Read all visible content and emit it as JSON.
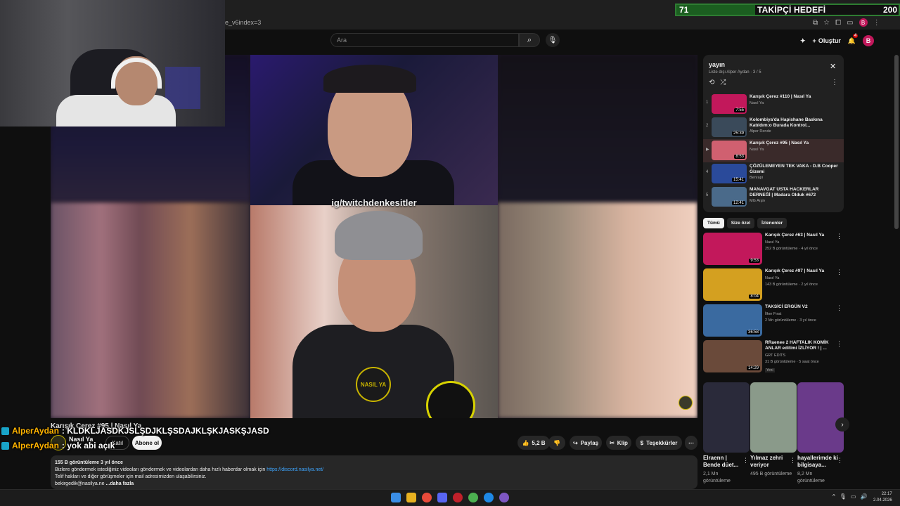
{
  "browser": {
    "url": "e_v6index=3",
    "profile_initial": "B"
  },
  "follower_goal": {
    "current": "71",
    "label": "TAKİPÇİ HEDEFİ",
    "target": "200",
    "progress": 0.355,
    "bar_color": "#2e7d32"
  },
  "youtube_header": {
    "search_placeholder": "Ara",
    "create_label": "Oluştur",
    "notification_count": "4",
    "avatar_initial": "B"
  },
  "player": {
    "watermark": "ig/twitchdenkesitler",
    "logo_text": "NASIL YA"
  },
  "video": {
    "title": "Karışık Çerez #95 | Nasıl Ya",
    "channel": "Nasıl Ya",
    "join_label": "Katıl",
    "subscribe_label": "Abone ol",
    "likes": "5,2 B",
    "share_label": "Paylaş",
    "clip_label": "Klip",
    "thanks_label": "Teşekkürler"
  },
  "chat": [
    {
      "user": "AlperAydan",
      "message": ": KLDKLJASDKJSLŞDJKLŞSDAJKLŞKJASKŞJASD"
    },
    {
      "user": "AlperAydan",
      "message": ": yok abi açık"
    }
  ],
  "description": {
    "stats": "155 B görüntüleme  3 yıl önce",
    "line1": "Bizlere göndermek istediğiniz videoları göndermek ve videolardan daha hızlı haberdar olmak için",
    "link": "https://discord.nasilya.net/",
    "line2": "Telif hakları ve diğer görüşmeler için mail adresimizden ulaşabilirsiniz.",
    "line3": "bekirgedik@nasilya.ne",
    "more": "...daha fazla"
  },
  "playlist": {
    "title": "yayın",
    "subtitle": "Liste dışı  Alper Aydan · 3 / 5",
    "items": [
      {
        "num": "1",
        "title": "Karışık Çerez #110 | Nasıl Ya",
        "channel": "Nasıl Ya",
        "duration": "7:55",
        "color": "#c2185b"
      },
      {
        "num": "2",
        "title": "Kolombiya'da Hapishane Baskına Katıldım:o Burada Kontrol...",
        "channel": "Alper Rende",
        "duration": "25:39",
        "color": "#3a4a5a"
      },
      {
        "num": "▶",
        "title": "Karışık Çerez #95 | Nasıl Ya",
        "channel": "Nasıl Ya",
        "duration": "8:53",
        "color": "#d06070"
      },
      {
        "num": "4",
        "title": "ÇÖZÜLEMEYEN TEK VAKA - D.B Cooper Gizemi",
        "channel": "Benrapi",
        "duration": "15:41",
        "color": "#2a4a9a"
      },
      {
        "num": "5",
        "title": "MANAVGAT USTA HACKERLAR DERNEĞİ | Madara Olduk #672",
        "channel": "MG Arşiv",
        "duration": "12:41",
        "color": "#4a6a8a"
      }
    ]
  },
  "chips": [
    "Tümü",
    "Size özel",
    "İzlenenler"
  ],
  "recommendations": [
    {
      "title": "Karışık Çerez #63 | Nasıl Ya",
      "channel": "Nasıl Ya",
      "meta": "252 B görüntüleme · 4 yıl önce",
      "duration": "9:53",
      "color": "#c2185b",
      "badge": ""
    },
    {
      "title": "Karışık Çerez #97 | Nasıl Ya",
      "channel": "Nasıl Ya",
      "meta": "143 B görüntüleme · 2 yıl önce",
      "duration": "8:04",
      "color": "#d4a020",
      "badge": ""
    },
    {
      "title": "TAKSİCİ ERGÜN V2",
      "channel": "İlker Fırat",
      "meta": "2 Mn görüntüleme · 3 yıl önce",
      "duration": "36:58",
      "color": "#3a6aa0",
      "badge": ""
    },
    {
      "title": "RRaenee 2 HAFTALIK KOMİK ANLAR editimi İZLİYOR ! | ...",
      "channel": "GRT EDİTS",
      "meta": "31 B görüntüleme · 5 saat önce",
      "duration": "14:29",
      "color": "#6a4a3a",
      "badge": "Yeni"
    }
  ],
  "shorts": [
    {
      "title": "Elraenn | Bende düet...",
      "views": "2,1 Mn görüntüleme",
      "color": "#2a2a3a"
    },
    {
      "title": "Yılmaz zehri veriyor",
      "views": "495 B görüntüleme",
      "color": "#8a9a8a"
    },
    {
      "title": "hayallerimde ki bilgisaya...",
      "views": "8,2 Mn görüntüleme",
      "color": "#6a3a8a"
    }
  ],
  "clock": {
    "time": "22:17",
    "date": "2.04.2026"
  }
}
